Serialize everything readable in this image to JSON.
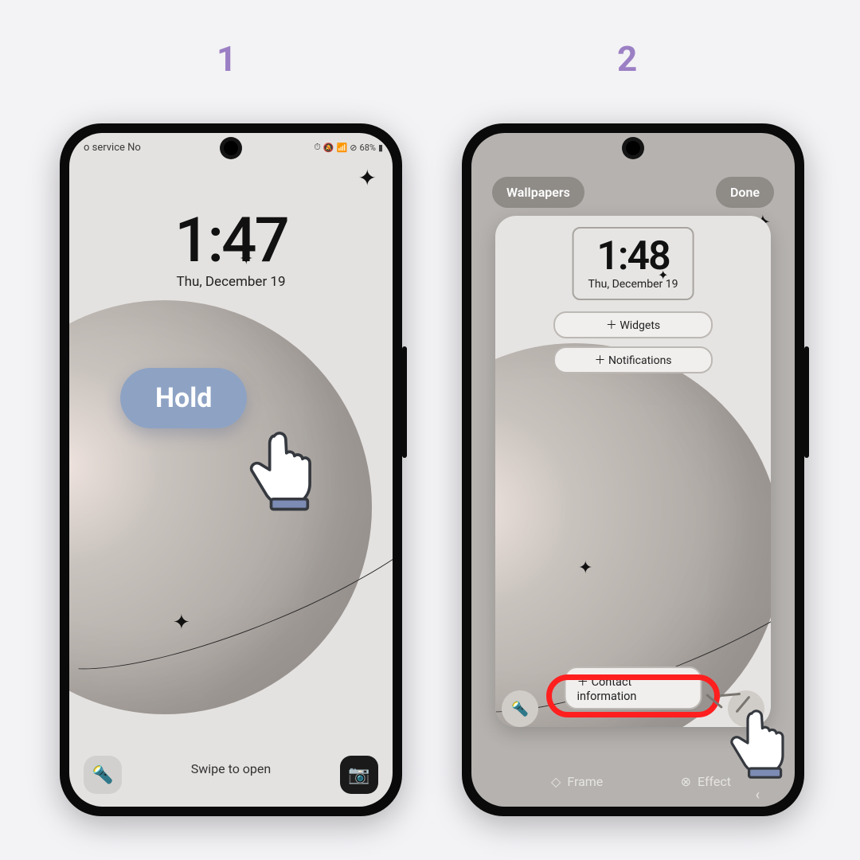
{
  "steps": {
    "one": "1",
    "two": "2"
  },
  "phone1": {
    "status_left": "o service    No",
    "battery": "68%",
    "clock": "1:47",
    "date": "Thu, December 19",
    "hold_label": "Hold",
    "swipe": "Swipe to open"
  },
  "phone2": {
    "wallpapers": "Wallpapers",
    "done": "Done",
    "clock": "1:48",
    "date": "Thu, December 19",
    "add_widgets": "＋ Widgets",
    "add_notifications": "＋ Notifications",
    "contact": "＋ Contact information",
    "frame": "Frame",
    "effect": "Effect"
  }
}
